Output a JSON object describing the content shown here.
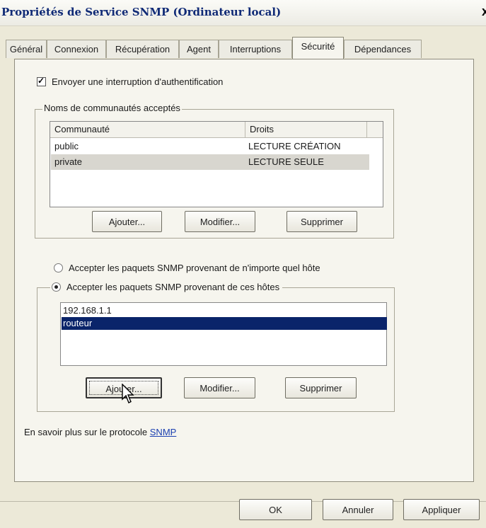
{
  "window": {
    "title": "Propriétés de Service SNMP (Ordinateur local)",
    "close_glyph": "x"
  },
  "tabs": [
    {
      "label": "Général"
    },
    {
      "label": "Connexion"
    },
    {
      "label": "Récupération"
    },
    {
      "label": "Agent"
    },
    {
      "label": "Interruptions"
    },
    {
      "label": "Sécurité",
      "active": true
    },
    {
      "label": "Dépendances"
    }
  ],
  "security": {
    "send_auth_trap": {
      "label": "Envoyer une interruption d'authentification",
      "checked": true
    },
    "communities": {
      "group_label": "Noms de communautés acceptés",
      "columns": [
        "Communauté",
        "Droits"
      ],
      "rows": [
        {
          "name": "public",
          "rights": "LECTURE CRÉATION"
        },
        {
          "name": "private",
          "rights": "LECTURE SEULE",
          "selected": true
        }
      ],
      "buttons": {
        "add": "Ajouter...",
        "edit": "Modifier...",
        "remove": "Supprimer"
      }
    },
    "radio_any_host": "Accepter les paquets SNMP provenant de n'importe quel hôte",
    "radio_these_hosts": "Accepter les paquets SNMP provenant de ces hôtes",
    "hosts": {
      "items": [
        "192.168.1.1",
        "routeur"
      ],
      "selected_index": 1,
      "buttons": {
        "add": "Ajouter...",
        "edit": "Modifier...",
        "remove": "Supprimer"
      }
    },
    "learn_more_prefix": "En savoir plus sur le protocole ",
    "learn_more_link": "SNMP"
  },
  "footer": {
    "ok": "OK",
    "cancel": "Annuler",
    "apply": "Appliquer"
  },
  "icons": {
    "cursor": "arrow-cursor-icon"
  }
}
